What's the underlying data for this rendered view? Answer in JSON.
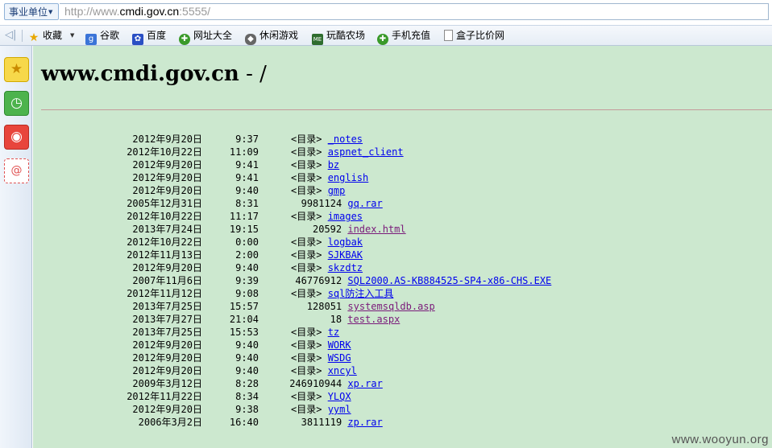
{
  "address_bar": {
    "zone_label": "事业单位",
    "url_scheme": "http://www.",
    "url_host": "cmdi.gov.cn",
    "url_port": ":5555/"
  },
  "favorites": [
    {
      "label": "收藏",
      "icon": "star-icon",
      "color": "#f0b400"
    },
    {
      "label": "谷歌",
      "icon": "google-icon",
      "color": "#3b74d8"
    },
    {
      "label": "百度",
      "icon": "baidu-paw-icon",
      "color": "#2a4fc4"
    },
    {
      "label": "网址大全",
      "icon": "hao123-icon",
      "color": "#3a9a2a"
    },
    {
      "label": "休闲游戏",
      "icon": "gamepad-icon",
      "color": "#555555"
    },
    {
      "label": "玩酷农场",
      "icon": "farm-me-icon",
      "color": "#2f6d2f"
    },
    {
      "label": "手机充值",
      "icon": "recharge-icon",
      "color": "#3a9a2a"
    },
    {
      "label": "盒子比价网",
      "icon": "page-icon",
      "color": "#ffffff"
    }
  ],
  "page": {
    "title_host": "www.cmdi.gov.cn",
    "title_path": " - /"
  },
  "listing": [
    {
      "date": "2012年9月20日",
      "time": "9:37",
      "meta": "<目录>",
      "name": "_notes",
      "visited": false
    },
    {
      "date": "2012年10月22日",
      "time": "11:09",
      "meta": "<目录>",
      "name": "aspnet_client",
      "visited": false
    },
    {
      "date": "2012年9月20日",
      "time": "9:41",
      "meta": "<目录>",
      "name": "bz",
      "visited": false
    },
    {
      "date": "2012年9月20日",
      "time": "9:41",
      "meta": "<目录>",
      "name": "english",
      "visited": false
    },
    {
      "date": "2012年9月20日",
      "time": "9:40",
      "meta": "<目录>",
      "name": "gmp",
      "visited": false
    },
    {
      "date": "2005年12月31日",
      "time": "8:31",
      "meta": "9981124",
      "name": "gq.rar",
      "visited": false
    },
    {
      "date": "2012年10月22日",
      "time": "11:17",
      "meta": "<目录>",
      "name": "images",
      "visited": false
    },
    {
      "date": "2013年7月24日",
      "time": "19:15",
      "meta": "20592",
      "name": "index.html",
      "visited": true
    },
    {
      "date": "2012年10月22日",
      "time": "0:00",
      "meta": "<目录>",
      "name": "logbak",
      "visited": false
    },
    {
      "date": "2012年11月13日",
      "time": "2:00",
      "meta": "<目录>",
      "name": "SJKBAK",
      "visited": false
    },
    {
      "date": "2012年9月20日",
      "time": "9:40",
      "meta": "<目录>",
      "name": "skzdtz",
      "visited": false
    },
    {
      "date": "2007年11月6日",
      "time": "9:39",
      "meta": "46776912",
      "name": "SQL2000.AS-KB884525-SP4-x86-CHS.EXE",
      "visited": false
    },
    {
      "date": "2012年11月12日",
      "time": "9:08",
      "meta": "<目录>",
      "name": "sql防注入工具",
      "visited": false
    },
    {
      "date": "2013年7月25日",
      "time": "15:57",
      "meta": "128051",
      "name": "systemsqldb.asp",
      "visited": true
    },
    {
      "date": "2013年7月27日",
      "time": "21:04",
      "meta": "18",
      "name": "test.aspx",
      "visited": true
    },
    {
      "date": "2013年7月25日",
      "time": "15:53",
      "meta": "<目录>",
      "name": "tz",
      "visited": false
    },
    {
      "date": "2012年9月20日",
      "time": "9:40",
      "meta": "<目录>",
      "name": "WORK",
      "visited": false
    },
    {
      "date": "2012年9月20日",
      "time": "9:40",
      "meta": "<目录>",
      "name": "WSDG",
      "visited": false
    },
    {
      "date": "2012年9月20日",
      "time": "9:40",
      "meta": "<目录>",
      "name": "xncyl",
      "visited": false
    },
    {
      "date": "2009年3月12日",
      "time": "8:28",
      "meta": "246910944",
      "name": "xp.rar",
      "visited": false
    },
    {
      "date": "2012年11月22日",
      "time": "8:34",
      "meta": "<目录>",
      "name": "YLQX",
      "visited": false
    },
    {
      "date": "2012年9月20日",
      "time": "9:38",
      "meta": "<目录>",
      "name": "yyml",
      "visited": false
    },
    {
      "date": "2006年3月2日",
      "time": "16:40",
      "meta": "3811119",
      "name": "zp.rar",
      "visited": false
    }
  ],
  "watermark": "www.wooyun.org"
}
